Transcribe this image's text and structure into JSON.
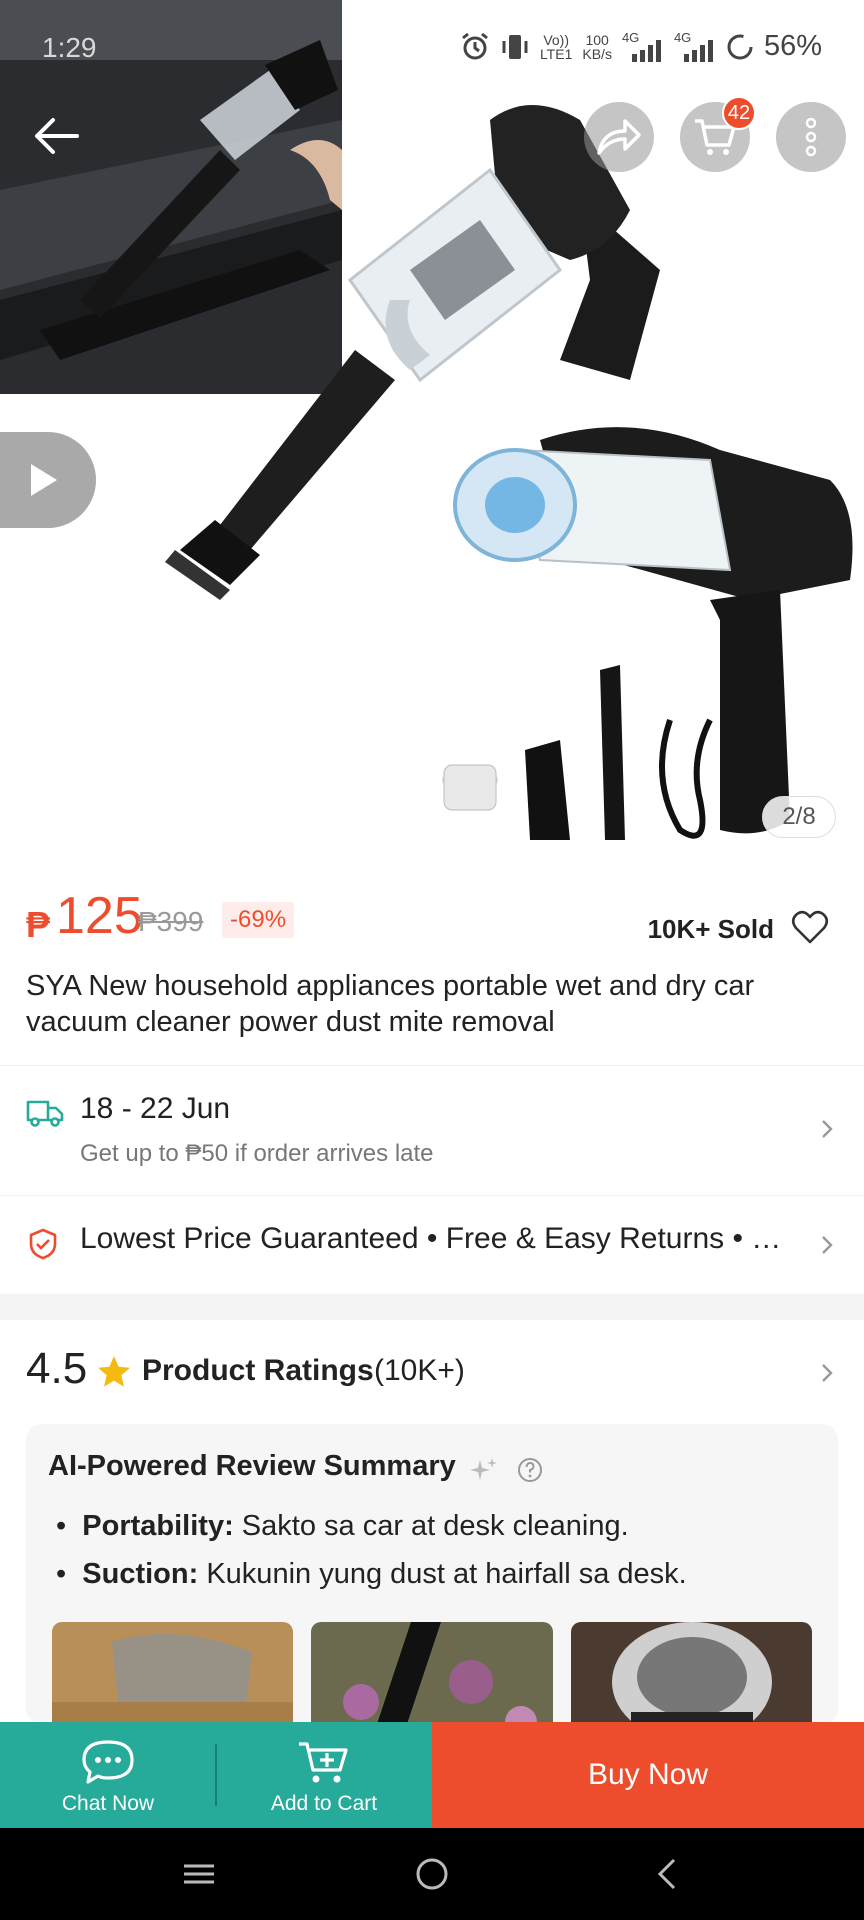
{
  "status_bar": {
    "time": "1:29",
    "net_speed_value": "100",
    "net_speed_unit": "KB/s",
    "volte_top": "Vo))",
    "volte_bottom": "LTE1",
    "signal1_label": "4G",
    "signal2_label": "4G",
    "battery": "56%"
  },
  "header": {
    "back_icon": "arrow-left-icon",
    "share_icon": "share-icon",
    "cart_icon": "cart-icon",
    "cart_count": "42",
    "more_icon": "more-vertical-icon"
  },
  "gallery": {
    "page_counter": "2/8",
    "play_icon": "play-icon"
  },
  "product": {
    "currency": "₱",
    "price": "125",
    "original_price": "₱399",
    "discount": "-69%",
    "sold": "10K+ Sold",
    "title": "SYA New household appliances portable wet and dry car vacuum cleaner power dust mite removal"
  },
  "shipping": {
    "date_range": "18 - 22 Jun",
    "guarantee_note": "Get up to ₱50 if order arrives late"
  },
  "guarantees": {
    "text": "Lowest Price Guaranteed  •  Free & Easy Returns  •  …"
  },
  "ratings": {
    "score": "4.5",
    "label": "Product Ratings",
    "count": "(10K+)"
  },
  "review_summary": {
    "title": "AI-Powered Review Summary",
    "items": [
      {
        "key": "Portability:",
        "text": " Sakto sa car at desk cleaning."
      },
      {
        "key": "Suction:",
        "text": " Kukunin yung dust at hairfall sa desk."
      }
    ]
  },
  "action_bar": {
    "chat_label": "Chat Now",
    "add_cart_label": "Add to Cart",
    "buy_label": "Buy Now"
  },
  "colors": {
    "brand": "#ee4d2d",
    "teal": "#26aa99"
  }
}
